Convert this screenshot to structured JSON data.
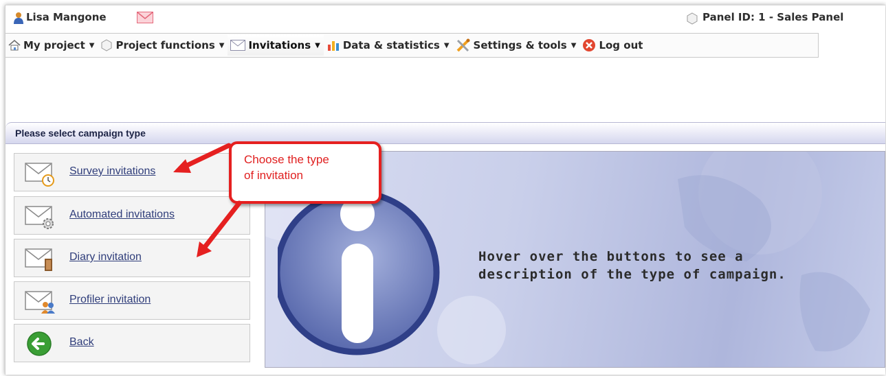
{
  "user": {
    "name": "Lisa Mangone",
    "panel": "Panel ID: 1 - Sales Panel"
  },
  "menu": [
    {
      "label": "My project",
      "icon": "home-icon"
    },
    {
      "label": "Project functions",
      "icon": "hexagon-icon"
    },
    {
      "label": "Invitations",
      "icon": "envelope-icon"
    },
    {
      "label": "Data & statistics",
      "icon": "chart-icon"
    },
    {
      "label": "Settings & tools",
      "icon": "tools-icon"
    },
    {
      "label": "Log out",
      "icon": "close-circle-icon"
    }
  ],
  "section": {
    "title": "Please select campaign type"
  },
  "buttons": [
    {
      "label": "Survey invitations",
      "icon": "envelope-clock-icon"
    },
    {
      "label": "Automated invitations",
      "icon": "envelope-gear-icon"
    },
    {
      "label": "Diary invitation",
      "icon": "envelope-book-icon"
    },
    {
      "label": "Profiler invitation",
      "icon": "envelope-people-icon"
    },
    {
      "label": "Back",
      "icon": "back-arrow-icon"
    }
  ],
  "info": {
    "line1": "Hover over the buttons to see a",
    "line2": "description of the type of campaign."
  },
  "callout": {
    "line1": "Choose the type",
    "line2": "of invitation"
  },
  "colors": {
    "accent": "#e52020",
    "link": "#2f3d7a",
    "header_text": "#1c2345"
  }
}
